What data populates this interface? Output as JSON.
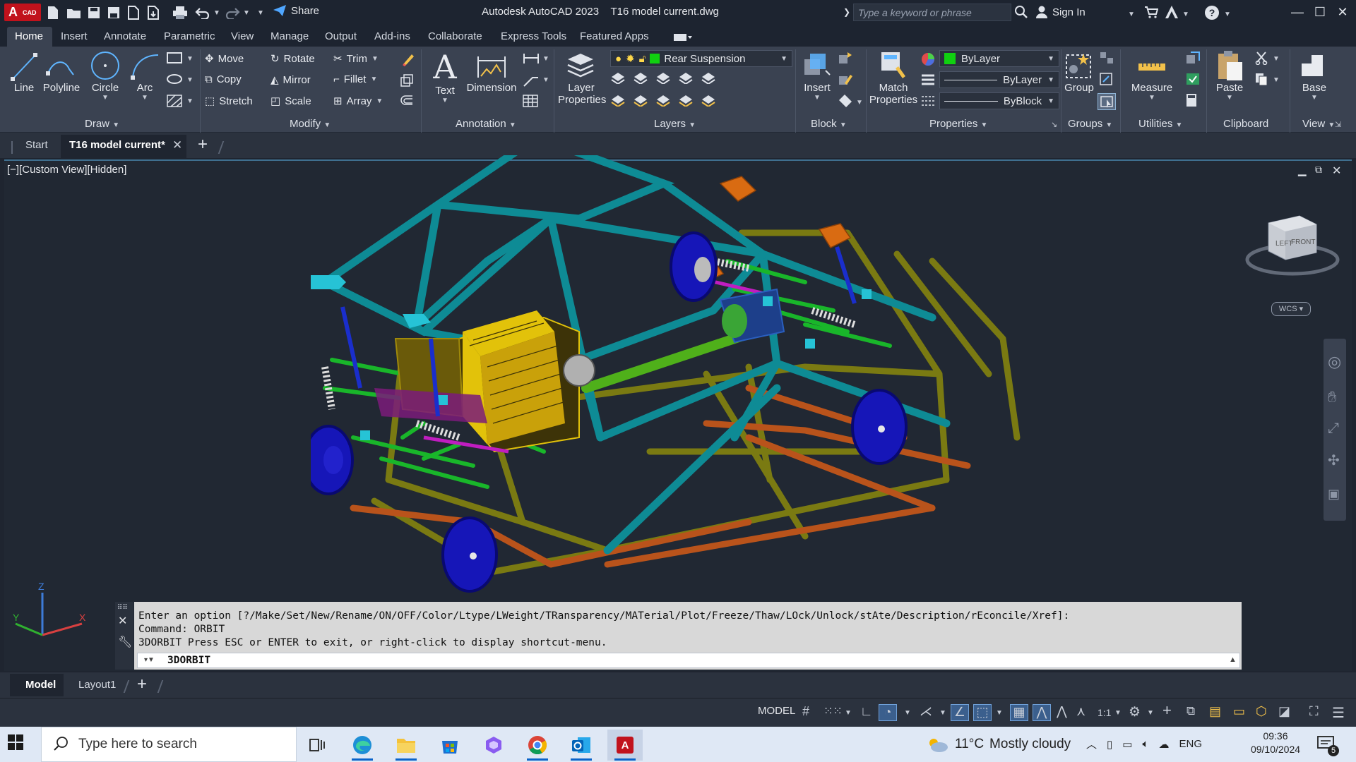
{
  "titlebar": {
    "app_badge_a": "A",
    "app_badge_cad": "CAD",
    "share_label": "Share",
    "title": "Autodesk AutoCAD 2023",
    "document": "T16 model current.dwg",
    "search_placeholder": "Type a keyword or phrase",
    "signin_label": "Sign In"
  },
  "ribbon_tabs": [
    "Home",
    "Insert",
    "Annotate",
    "Parametric",
    "View",
    "Manage",
    "Output",
    "Add-ins",
    "Collaborate",
    "Express Tools",
    "Featured Apps"
  ],
  "ribbon": {
    "draw": {
      "title": "Draw",
      "line": "Line",
      "polyline": "Polyline",
      "circle": "Circle",
      "arc": "Arc"
    },
    "modify": {
      "title": "Modify",
      "move": "Move",
      "rotate": "Rotate",
      "trim": "Trim",
      "copy": "Copy",
      "mirror": "Mirror",
      "fillet": "Fillet",
      "stretch": "Stretch",
      "scale": "Scale",
      "array": "Array"
    },
    "annotation": {
      "title": "Annotation",
      "text": "Text",
      "dimension": "Dimension"
    },
    "layers": {
      "title": "Layers",
      "layer_properties_1": "Layer",
      "layer_properties_2": "Properties",
      "current_layer": "Rear Suspension",
      "layer_color": "#10d010"
    },
    "block": {
      "title": "Block",
      "insert": "Insert"
    },
    "properties": {
      "title": "Properties",
      "match_1": "Match",
      "match_2": "Properties",
      "color_value": "ByLayer",
      "linetype_value": "ByLayer",
      "lineweight_value": "ByBlock"
    },
    "groups": {
      "title": "Groups",
      "group": "Group"
    },
    "utilities": {
      "title": "Utilities",
      "measure": "Measure"
    },
    "clipboard": {
      "title": "Clipboard",
      "paste": "Paste"
    },
    "view": {
      "title": "View",
      "base": "Base"
    }
  },
  "doc_tabs": {
    "start": "Start",
    "active": "T16 model current*"
  },
  "viewport": {
    "label": "[−][Custom View][Hidden]",
    "viewcube_left": "LEFT",
    "viewcube_front": "FRONT",
    "wcs": "WCS"
  },
  "command": {
    "line1": "Enter an option [?/Make/Set/New/Rename/ON/OFF/Color/Ltype/LWeight/TRansparency/MATerial/Plot/Freeze/Thaw/LOck/Unlock/stAte/Description/rEconcile/Xref]:",
    "line2": "Command: ORBIT",
    "line3": "3DORBIT Press ESC or ENTER to exit, or right-click to display shortcut-menu.",
    "input": "3DORBIT"
  },
  "layout_tabs": {
    "model": "Model",
    "layout1": "Layout1"
  },
  "status": {
    "mode": "MODEL",
    "scale": "1:1"
  },
  "taskbar": {
    "search_placeholder": "Type here to search",
    "weather_temp": "11°C",
    "weather_desc": "Mostly cloudy",
    "language": "ENG",
    "time": "09:36",
    "date": "09/10/2024",
    "notification_count": "5"
  },
  "colors": {
    "accent": "#3f6f8f",
    "frame_teal": "#0e8b95",
    "frame_olive": "#7a7a12",
    "engine_yellow": "#e2c20a",
    "wheel_blue": "#1616b8",
    "autocad_red": "#c1121c"
  }
}
